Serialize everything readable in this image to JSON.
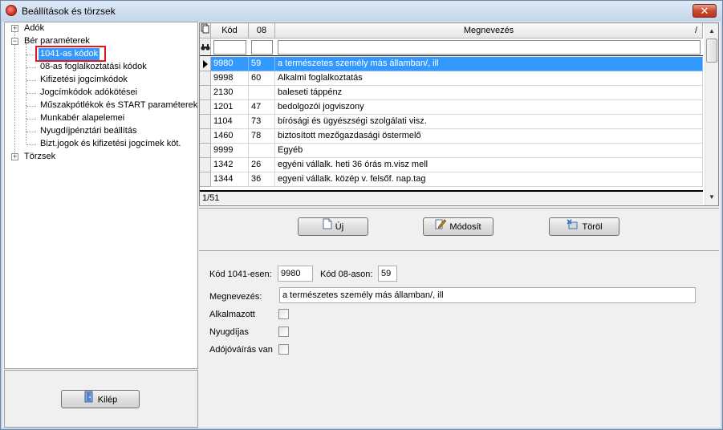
{
  "window": {
    "title": "Beállítások és törzsek",
    "close_glyph": "✕"
  },
  "tree": {
    "items": [
      {
        "label": "Adók",
        "expander": "+"
      },
      {
        "label": "Bér paraméterek",
        "expander": "−"
      },
      {
        "label": "1041-as kódok"
      },
      {
        "label": "08-as foglalkoztatási kódok"
      },
      {
        "label": "Kifizetési jogcímkódok"
      },
      {
        "label": "Jogcímkódok adókötései"
      },
      {
        "label": "Műszakpótlékok és START paraméterek"
      },
      {
        "label": "Munkabér alapelemei"
      },
      {
        "label": "Nyugdíjpénztári beállítás"
      },
      {
        "label": "Bizt.jogok és kifizetési jogcímek köt."
      },
      {
        "label": "Törzsek",
        "expander": "+"
      }
    ]
  },
  "exit_button": {
    "label": "Kilép"
  },
  "grid": {
    "columns": [
      "Kód",
      "08",
      "Megnevezés"
    ],
    "sort_glyph": "/",
    "rows": [
      [
        "9980",
        "59",
        "a természetes személy más államban/, ill"
      ],
      [
        "9998",
        "60",
        "Alkalmi foglalkoztatás"
      ],
      [
        "2130",
        "",
        "baleseti táppénz"
      ],
      [
        "1201",
        "47",
        "bedolgozói jogviszony"
      ],
      [
        "1104",
        "73",
        "bírósági és ügyészségi szolgálati visz."
      ],
      [
        "1460",
        "78",
        "biztosított mezőgazdasági östermelő"
      ],
      [
        "9999",
        "",
        "Egyéb"
      ],
      [
        "1342",
        "26",
        "egyéni vállalk. heti 36 órás m.visz mell"
      ],
      [
        "1344",
        "36",
        "egyeni vállalk. közép v. felsőf. nap.tag"
      ]
    ],
    "status": "1/51"
  },
  "actions": {
    "new_label": "Új",
    "modify_label": "Módosít",
    "delete_label": "Töröl"
  },
  "form": {
    "code_1041_label": "Kód 1041-esen:",
    "code_1041_value": "9980",
    "code_08_label": "Kód 08-ason:",
    "code_08_value": "59",
    "name_label": "Megnevezés:",
    "name_value": "a természetes személy más államban/, ill",
    "employee_label": "Alkalmazott",
    "pension_label": "Nyugdíjas",
    "tax_label": "Adójóváírás van"
  }
}
